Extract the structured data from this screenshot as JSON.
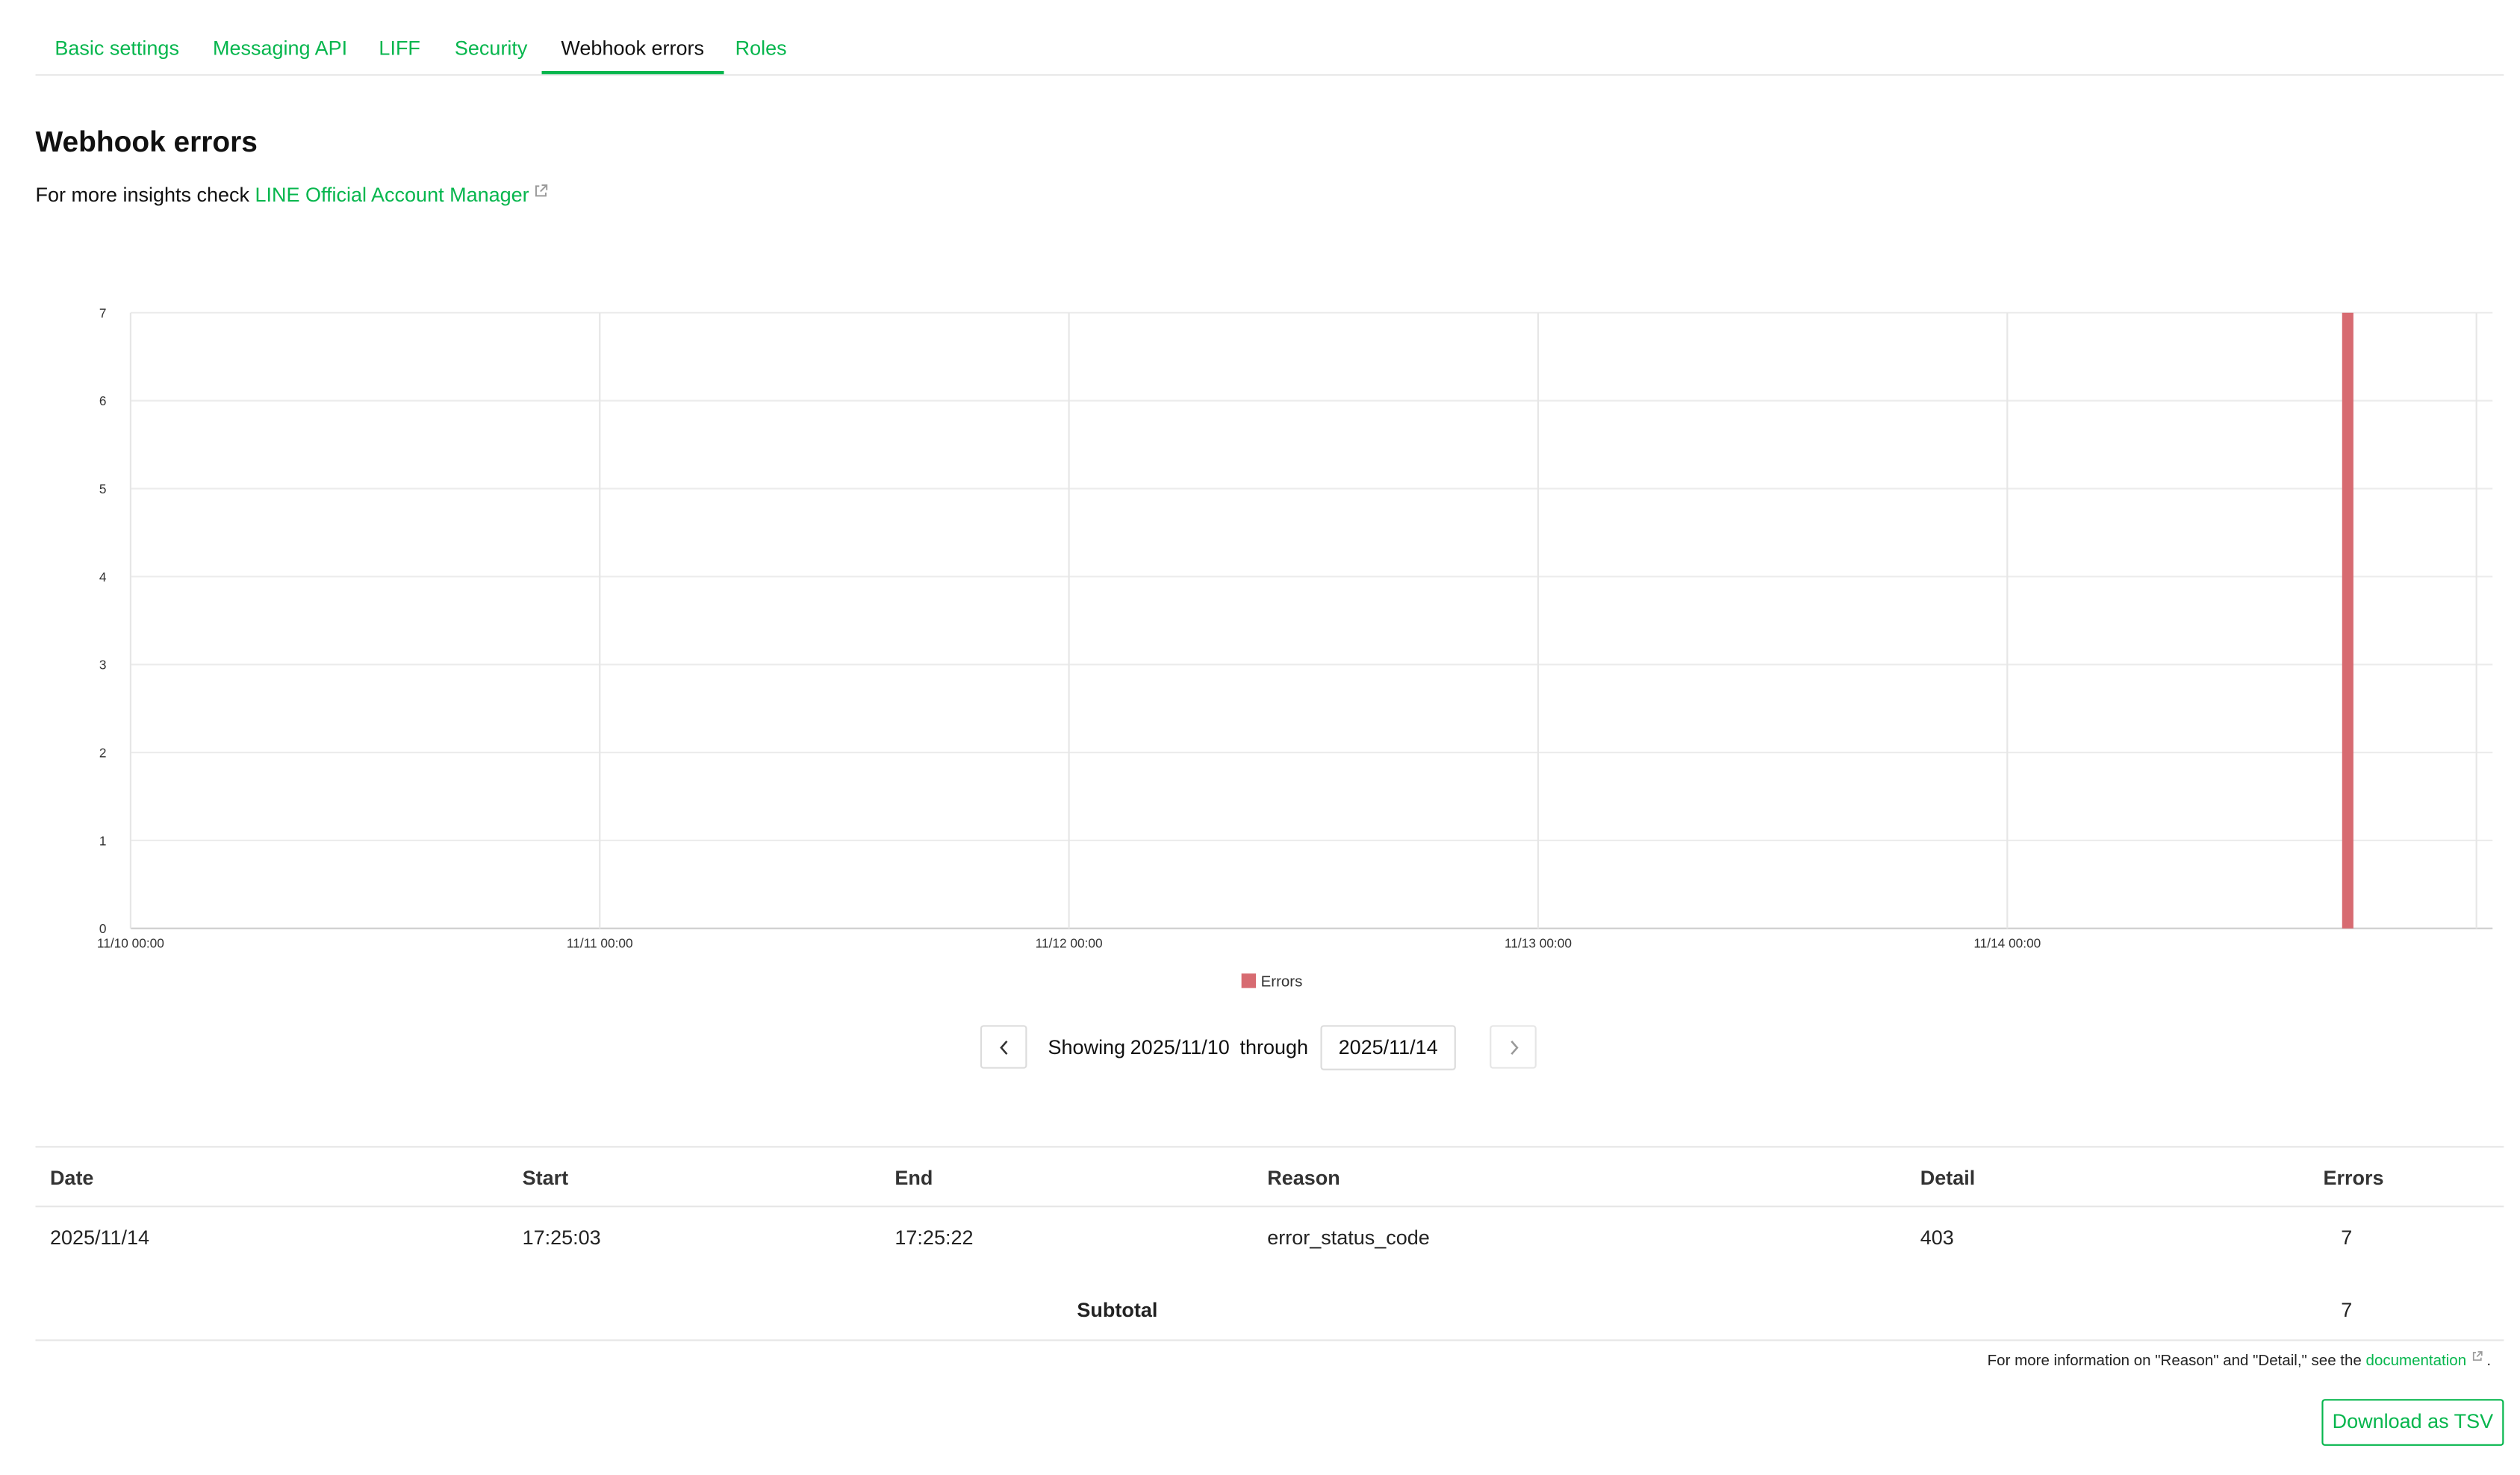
{
  "tabs": [
    {
      "label": "Basic settings",
      "active": false
    },
    {
      "label": "Messaging API",
      "active": false
    },
    {
      "label": "LIFF",
      "active": false
    },
    {
      "label": "Security",
      "active": false
    },
    {
      "label": "Webhook errors",
      "active": true
    },
    {
      "label": "Roles",
      "active": false
    }
  ],
  "page": {
    "title": "Webhook errors",
    "insight_prefix": "For more insights check",
    "insight_link": "LINE Official Account Manager"
  },
  "chart_data": {
    "type": "bar",
    "x_ticks": [
      "11/10 00:00",
      "11/11 00:00",
      "11/12 00:00",
      "11/13 00:00",
      "11/14 00:00"
    ],
    "x_range": [
      "2025/11/10 00:00",
      "2025/11/15 00:00"
    ],
    "ylim": [
      0,
      7
    ],
    "y_ticks": [
      0,
      1,
      2,
      3,
      4,
      5,
      6,
      7
    ],
    "series": [
      {
        "name": "Errors",
        "color": "#d76b71",
        "points": [
          {
            "x": "2025/11/14 17:25",
            "y": 7
          }
        ]
      }
    ],
    "legend": "bottom-center",
    "grid": true
  },
  "pager": {
    "showing_label": "Showing",
    "start_date": "2025/11/10",
    "through_label": "through",
    "end_date": "2025/11/14"
  },
  "table": {
    "columns": [
      "Date",
      "Start",
      "End",
      "Reason",
      "Detail",
      "Errors"
    ],
    "rows": [
      {
        "date": "2025/11/14",
        "start": "17:25:03",
        "end": "17:25:22",
        "reason": "error_status_code",
        "detail": "403",
        "errors": "7"
      }
    ],
    "subtotal_label": "Subtotal",
    "subtotal_value": "7"
  },
  "footnote": {
    "text": "For more information on \"Reason\" and \"Detail,\" see the",
    "link": "documentation",
    "end": "."
  },
  "download_label": "Download as TSV",
  "colors": {
    "accent": "#06b64d",
    "error_bar": "#d76b71"
  },
  "icons": {
    "external_link": "external-link-icon",
    "prev": "chevron-left-icon",
    "next": "chevron-right-icon"
  }
}
